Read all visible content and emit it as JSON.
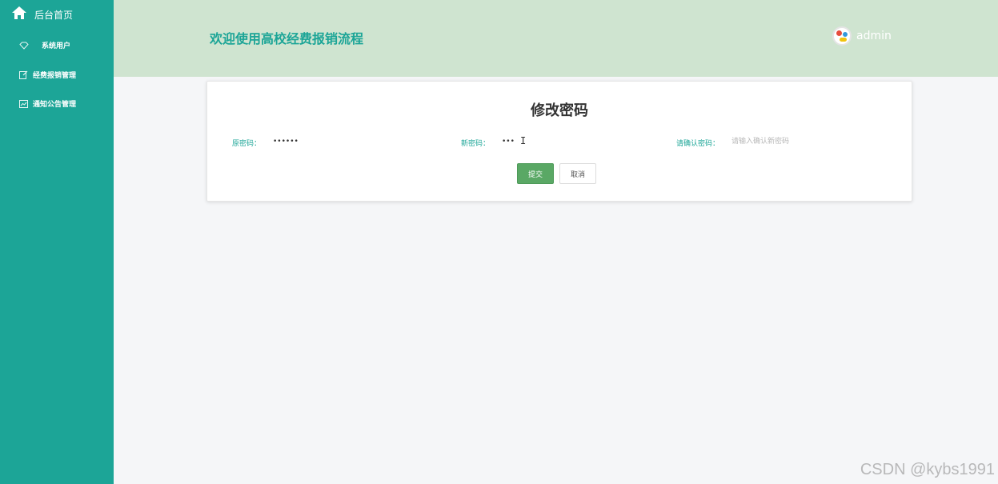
{
  "sidebar": {
    "home_label": "后台首页",
    "items": [
      {
        "label": "系统用户",
        "icon": "diamond-outline-icon"
      },
      {
        "label": "经费报销管理",
        "icon": "edit-note-icon"
      },
      {
        "label": "通知公告管理",
        "icon": "line-chart-icon"
      }
    ]
  },
  "header": {
    "title": "欢迎使用高校经费报销流程",
    "username": "admin"
  },
  "form": {
    "title": "修改密码",
    "old_password_label": "原密码：",
    "old_password_value": "••••••",
    "new_password_label": "新密码：",
    "new_password_value": "•••",
    "confirm_label": "请确认密码：",
    "confirm_placeholder": "请输入确认新密码",
    "submit_label": "提交",
    "cancel_label": "取消"
  },
  "watermark": "CSDN @kybs1991",
  "colors": {
    "sidebar_bg": "#1ca597",
    "header_bg": "#cfe4d0",
    "accent": "#1ca597",
    "submit_bg": "#5aa865"
  }
}
